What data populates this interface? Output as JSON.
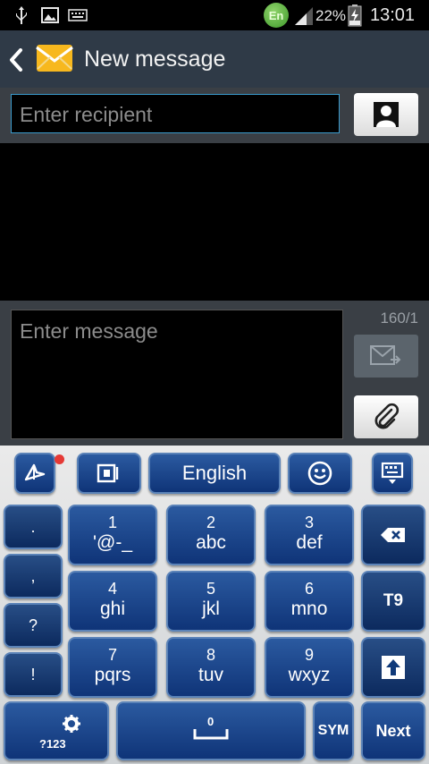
{
  "status_bar": {
    "language_badge": "En",
    "battery_percent": "22%",
    "time": "13:01",
    "icons": [
      "usb-icon",
      "image-icon",
      "keyboard-icon",
      "signal-icon",
      "battery-charging-icon"
    ]
  },
  "header": {
    "title": "New message",
    "icons": [
      "back-icon",
      "messages-envelope-icon"
    ]
  },
  "recipient": {
    "placeholder": "Enter recipient"
  },
  "compose": {
    "placeholder": "Enter message",
    "char_counter": "160/1"
  },
  "keyboard": {
    "language_label": "English",
    "side_keys": [
      ".",
      ",",
      "?",
      "!"
    ],
    "digit_keys": [
      {
        "num": "1",
        "letters": "'@-_"
      },
      {
        "num": "2",
        "letters": "abc"
      },
      {
        "num": "3",
        "letters": "def"
      },
      {
        "num": "4",
        "letters": "ghi"
      },
      {
        "num": "5",
        "letters": "jkl"
      },
      {
        "num": "6",
        "letters": "mno"
      },
      {
        "num": "7",
        "letters": "pqrs"
      },
      {
        "num": "8",
        "letters": "tuv"
      },
      {
        "num": "9",
        "letters": "wxyz"
      }
    ],
    "t9_label": "T9",
    "sym_label": "SYM",
    "next_label": "Next",
    "num_mode_label": "?123",
    "space_num": "0"
  },
  "colors": {
    "accent": "#3a9acc",
    "key_blue": "#1a4488",
    "action_bar": "#2f3a47",
    "badge_green": "#4caf50",
    "notification_red": "#e53935"
  }
}
